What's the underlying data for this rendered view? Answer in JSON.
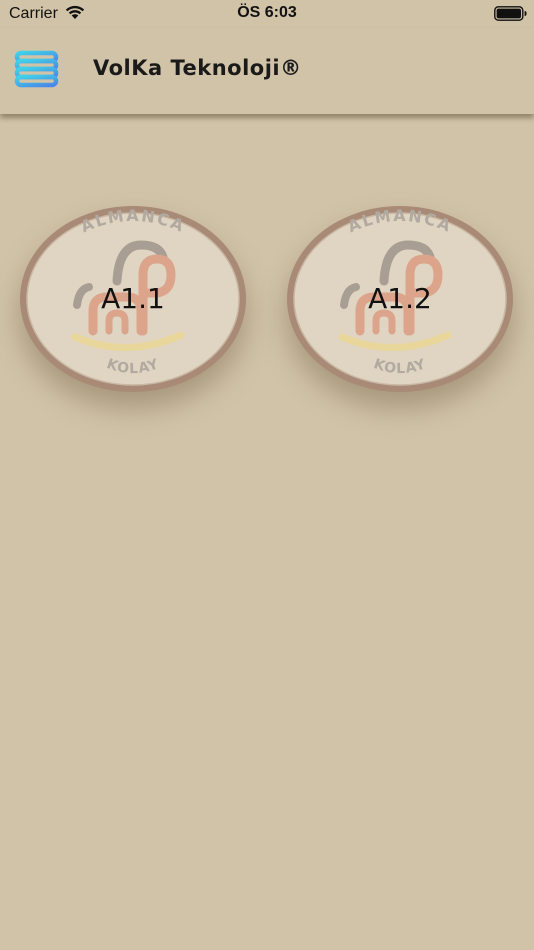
{
  "status_bar": {
    "carrier": "Carrier",
    "time": "ÖS 6:03"
  },
  "header": {
    "title": "VolKa Teknoloji®",
    "menu_icon": "stacked-lines-icon"
  },
  "badges": [
    {
      "label": "A1.1",
      "top_text": "ALMANCA",
      "bottom_text": "KOLAY"
    },
    {
      "label": "A1.2",
      "top_text": "ALMANCA",
      "bottom_text": "KOLAY"
    }
  ],
  "colors": {
    "background": "#d1c3a8",
    "badge_fill": "#e0d5c2",
    "badge_rim": "#a88a77",
    "logo_peach": "#dba48b",
    "logo_gray": "#a89e93",
    "logo_yellow": "#e8d69a",
    "menu_cyan": "#3fd3e8",
    "menu_blue": "#4a86e8"
  }
}
